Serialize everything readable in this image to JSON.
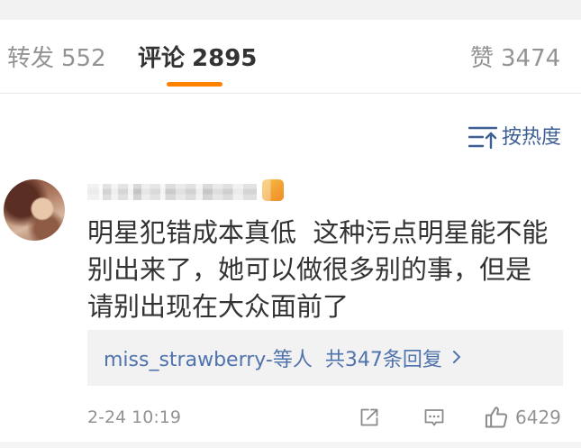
{
  "tabs": [
    {
      "label": "转发",
      "count": "552",
      "active": false
    },
    {
      "label": "评论",
      "count": "2895",
      "active": true
    },
    {
      "label": "赞",
      "count": "3474",
      "active": false
    }
  ],
  "sort": {
    "icon": "sort-icon",
    "label": "按热度"
  },
  "comment": {
    "badge_icon": "member-badge-icon",
    "text_lines": [
      "明星犯错成本真低  这种污点明星能不能",
      "别出来了，她可以做很多别的事，但是",
      "请别出现在大众面前了"
    ],
    "replies": {
      "users": "miss_strawberry-等人",
      "count_label": "共347条回复",
      "chevron_icon": "chevron-right-icon"
    },
    "time": "2-24 10:19",
    "actions": {
      "share_icon": "share-icon",
      "comment_icon": "comment-icon",
      "like_icon": "thumbs-up-icon",
      "like_count": "6429"
    }
  },
  "colors": {
    "accent": "#ff8200",
    "link": "#4f73ad",
    "sort": "#3e5f93",
    "text": "#333333",
    "muted": "#939393",
    "icon": "#8a8a8a",
    "panel": "#f2f2f2",
    "divider": "#e9e9e9"
  }
}
